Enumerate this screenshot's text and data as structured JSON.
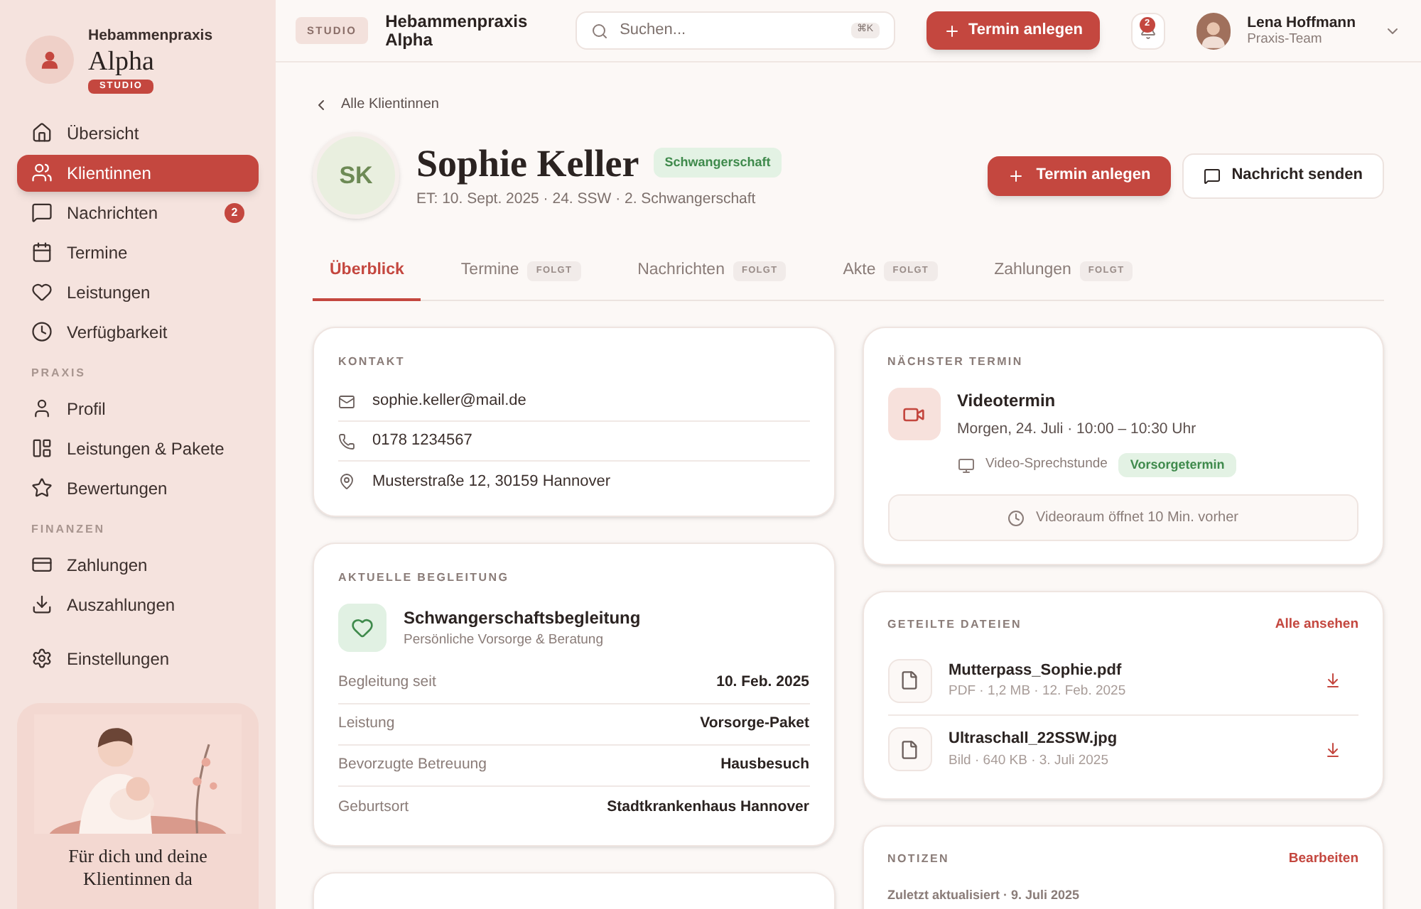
{
  "sidebar": {
    "brand": {
      "subtitle": "Hebammenpraxis",
      "name": "Alpha",
      "badge": "STUDIO"
    },
    "nav": [
      {
        "kind": "home",
        "label": "Übersicht",
        "selected": false
      },
      {
        "kind": "users",
        "label": "Klientinnen",
        "selected": true
      },
      {
        "kind": "message",
        "label": "Nachrichten",
        "selected": false,
        "badge": "2"
      },
      {
        "kind": "calendar",
        "label": "Termine",
        "selected": false
      },
      {
        "kind": "heart",
        "label": "Leistungen",
        "selected": false
      },
      {
        "kind": "clock",
        "label": "Verfügbarkeit",
        "selected": false
      }
    ],
    "sections": [
      {
        "title": "PRAXIS",
        "items": [
          {
            "kind": "user",
            "label": "Profil",
            "selected": false
          },
          {
            "kind": "table",
            "label": "Leistungen & Pakete",
            "selected": false
          },
          {
            "kind": "star",
            "label": "Bewertungen",
            "selected": false
          }
        ]
      },
      {
        "title": "FINANZEN",
        "items": [
          {
            "kind": "card",
            "label": "Zahlungen",
            "selected": false
          },
          {
            "kind": "download",
            "label": "Auszahlungen",
            "selected": false
          }
        ]
      }
    ],
    "settings": {
      "kind": "gear",
      "label": "Einstellungen",
      "selected": false
    },
    "promo": {
      "text": "Für dich und deine Klientinnen da"
    }
  },
  "topbar": {
    "badge": "STUDIO",
    "title": "Hebammenpraxis Alpha",
    "search": {
      "placeholder": "Suchen...",
      "shortcut": "⌘K"
    },
    "new_button": "Termin anlegen",
    "notifications": "2",
    "user": {
      "name": "Lena Hoffmann",
      "role": "Praxis-Team"
    }
  },
  "back_link": "Alle Klientinnen",
  "client": {
    "initials": "SK",
    "name": "Sophie Keller",
    "tag": "Schwangerschaft",
    "meta": "ET: 10. Sept. 2025 · 24. SSW · 2. Schwangerschaft"
  },
  "actions": {
    "primary": "Termin anlegen",
    "secondary": "Nachricht senden"
  },
  "tabs": [
    {
      "label": "Überblick",
      "selected": true
    },
    {
      "label": "Termine",
      "selected": false,
      "tag": "FOLGT"
    },
    {
      "label": "Nachrichten",
      "selected": false,
      "tag": "FOLGT"
    },
    {
      "label": "Akte",
      "selected": false,
      "tag": "FOLGT"
    },
    {
      "label": "Zahlungen",
      "selected": false,
      "tag": "FOLGT"
    }
  ],
  "contact": {
    "title": "KONTAKT",
    "rows": [
      {
        "kind": "mail",
        "text": "sophie.keller@mail.de"
      },
      {
        "kind": "phone",
        "text": "0178 1234567"
      },
      {
        "kind": "pin",
        "text": "Musterstraße 12, 30159 Hannover"
      }
    ]
  },
  "care": {
    "title": "AKTUELLE BEGLEITUNG",
    "name": "Schwangerschaftsbegleitung",
    "subtitle": "Persönliche Vorsorge & Beratung",
    "rows": [
      {
        "label": "Begleitung seit",
        "value": "10. Feb. 2025"
      },
      {
        "label": "Leistung",
        "value": "Vorsorge-Paket"
      },
      {
        "label": "Bevorzugte Betreuung",
        "value": "Hausbesuch"
      },
      {
        "label": "Geburtsort",
        "value": "Stadtkrankenhaus Hannover"
      }
    ]
  },
  "next_appointment": {
    "title": "NÄCHSTER TERMIN",
    "name": "Videotermin",
    "when": "Morgen, 24. Juli · 10:00 – 10:30 Uhr",
    "channel": "Video-Sprechstunde",
    "tag": "Vorsorgetermin",
    "note": "Videoraum öffnet 10 Min. vorher"
  },
  "files": {
    "title": "GETEILTE DATEIEN",
    "link": "Alle ansehen",
    "items": [
      {
        "name": "Mutterpass_Sophie.pdf",
        "meta": "PDF · 1,2 MB · 12. Feb. 2025"
      },
      {
        "name": "Ultraschall_22SSW.jpg",
        "meta": "Bild · 640 KB · 3. Juli 2025"
      }
    ]
  },
  "notes": {
    "title": "NOTIZEN",
    "link": "Bearbeiten",
    "updated": "Zuletzt aktualisiert · 9. Juli 2025"
  }
}
